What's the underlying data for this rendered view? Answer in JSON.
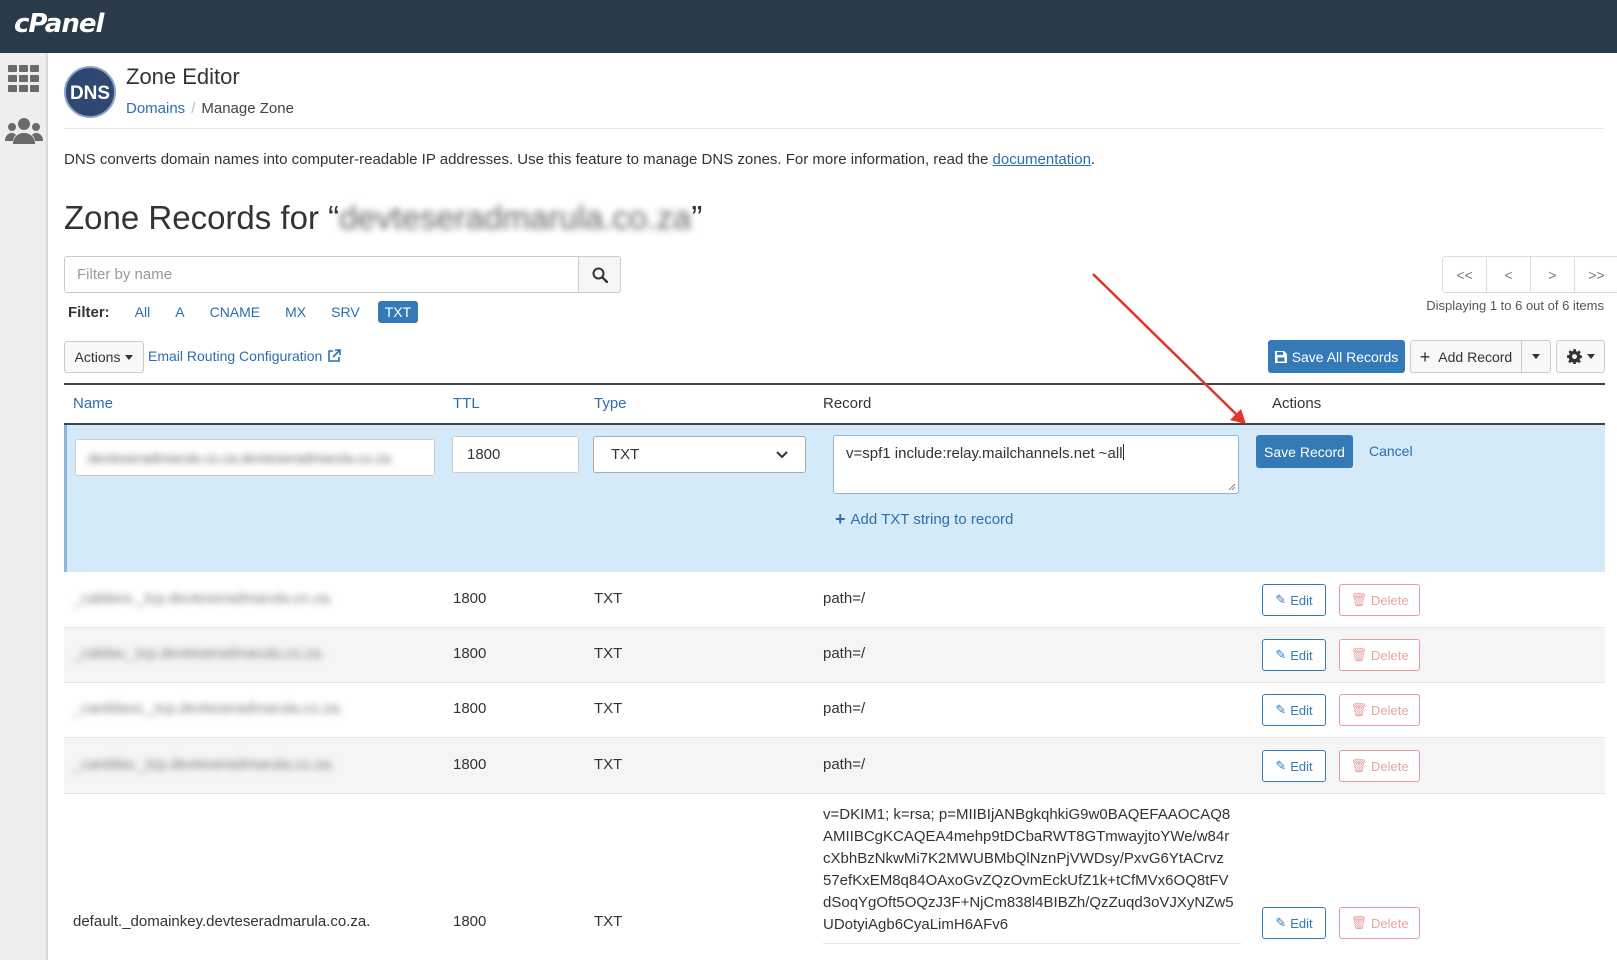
{
  "app": {
    "logo": "cPanel"
  },
  "header": {
    "dns_logo": "DNS",
    "title": "Zone Editor",
    "breadcrumb": {
      "link": "Domains",
      "separator": "/",
      "current": "Manage Zone"
    }
  },
  "intro": {
    "text": "DNS converts domain names into computer-readable IP addresses. Use this feature to manage DNS zones. For more information, read the ",
    "link": "documentation",
    "end": "."
  },
  "zone": {
    "heading_prefix": "Zone Records for “",
    "domain": "devteseradmarula.co.za",
    "heading_suffix": "”"
  },
  "search": {
    "placeholder": "Filter by name"
  },
  "filter": {
    "label": "Filter:",
    "options": [
      "All",
      "A",
      "CNAME",
      "MX",
      "SRV",
      "TXT"
    ],
    "active": "TXT"
  },
  "pagination": {
    "buttons": [
      "<<",
      "<",
      ">",
      ">>"
    ],
    "status": "Displaying 1 to 6 out of 6 items"
  },
  "toolbar": {
    "actions": "Actions",
    "email_routing": "Email Routing Configuration",
    "save_all": "Save All Records",
    "add_record": "Add Record"
  },
  "table": {
    "headers": {
      "name": "Name",
      "ttl": "TTL",
      "type": "Type",
      "record": "Record",
      "actions": "Actions"
    }
  },
  "edit_row": {
    "name": "devteseradmarula.co.za.devteseradmarula.co.za",
    "ttl": "1800",
    "type": "TXT",
    "record": "v=spf1 include:relay.mailchannels.net ~all",
    "add_txt": "Add TXT string to record",
    "save": "Save Record",
    "cancel": "Cancel"
  },
  "rows": [
    {
      "name": "_caldavs._tcp.devteseradmarula.co.za.",
      "ttl": "1800",
      "type": "TXT",
      "record": "path=/"
    },
    {
      "name": "_caldav._tcp.devteseradmarula.co.za.",
      "ttl": "1800",
      "type": "TXT",
      "record": "path=/"
    },
    {
      "name": "_carddavs._tcp.devteseradmarula.co.za.",
      "ttl": "1800",
      "type": "TXT",
      "record": "path=/"
    },
    {
      "name": "_carddav._tcp.devteseradmarula.co.za.",
      "ttl": "1800",
      "type": "TXT",
      "record": "path=/"
    },
    {
      "name": "default._domainkey.devteseradmarula.co.za.",
      "ttl": "1800",
      "type": "TXT",
      "record_lines": [
        "v=DKIM1; k=rsa; p=MIIBIjANBgkqhkiG9w0BAQEFAAOCAQ8",
        "AMIIBCgKCAQEA4mehp9tDCbaRWT8GTmwayjtoYWe/w84r",
        "cXbhBzNkwMi7K2MWUBMbQlNznPjVWDsy/PxvG6YtACrvz",
        "57efKxEM8q84OAxoGvZQzOvmEckUfZ1k+tCfMVx6OQ8tFV",
        "dSoqYgOft5OQzJ3F+NjCm838l4BIBZh/QzZuqd3oVJXyNZw5",
        "UDotyiAgb6CyaLimH6AFv6"
      ]
    }
  ],
  "row_actions": {
    "edit": "Edit",
    "delete": "Delete"
  },
  "colors": {
    "topbar": "#293a4a",
    "primary": "#337ab7",
    "edit_row_bg": "#d4eaf8",
    "delete": "#e39a98",
    "annotation_arrow": "#e53222"
  }
}
